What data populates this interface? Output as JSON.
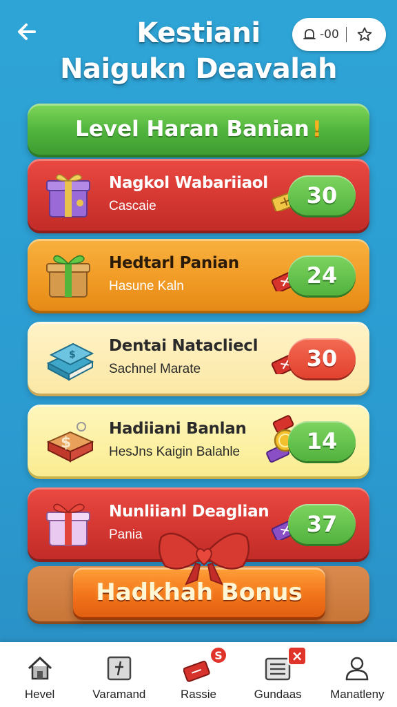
{
  "header": {
    "title_line1": "Kestiani",
    "title_line2": "Naigukn Deavalah",
    "status_count": "-00"
  },
  "banner": {
    "text": "Level Haran Banian",
    "mark": "!"
  },
  "cards": [
    {
      "title": "Nagkol Wabariiaol",
      "subtitle": "Cascaie",
      "value": "30",
      "style": "red",
      "pill": "green",
      "icon": "purple-gift-box-icon"
    },
    {
      "title": "Hedtarl Panian",
      "subtitle": "Hasune Kaln",
      "value": "24",
      "style": "orange",
      "pill": "green",
      "icon": "green-ribbon-gift-icon"
    },
    {
      "title": "Dentai Natacliecl",
      "subtitle": "Sachnel Marate",
      "value": "30",
      "style": "cream",
      "pill": "red",
      "icon": "blue-book-icon"
    },
    {
      "title": "Hadiiani Banlan",
      "subtitle": "HesJns Kaigin Balahle",
      "value": "14",
      "style": "yellow",
      "pill": "green",
      "icon": "dollar-box-icon"
    },
    {
      "title": "Nunliianl Deaglian",
      "subtitle": "Pania",
      "value": "37",
      "style": "red",
      "pill": "green",
      "icon": "pink-gift-box-icon"
    }
  ],
  "bonus": {
    "label": "Hadkhah Bonus"
  },
  "nav": [
    {
      "label": "Hevel",
      "icon": "home-icon"
    },
    {
      "label": "Varamand",
      "icon": "note-icon"
    },
    {
      "label": "Rassie",
      "icon": "ticket-badge-icon",
      "badge": "S"
    },
    {
      "label": "Gundaas",
      "icon": "list-badge-icon",
      "badge": "×"
    },
    {
      "label": "Manatleny",
      "icon": "profile-icon"
    }
  ]
}
